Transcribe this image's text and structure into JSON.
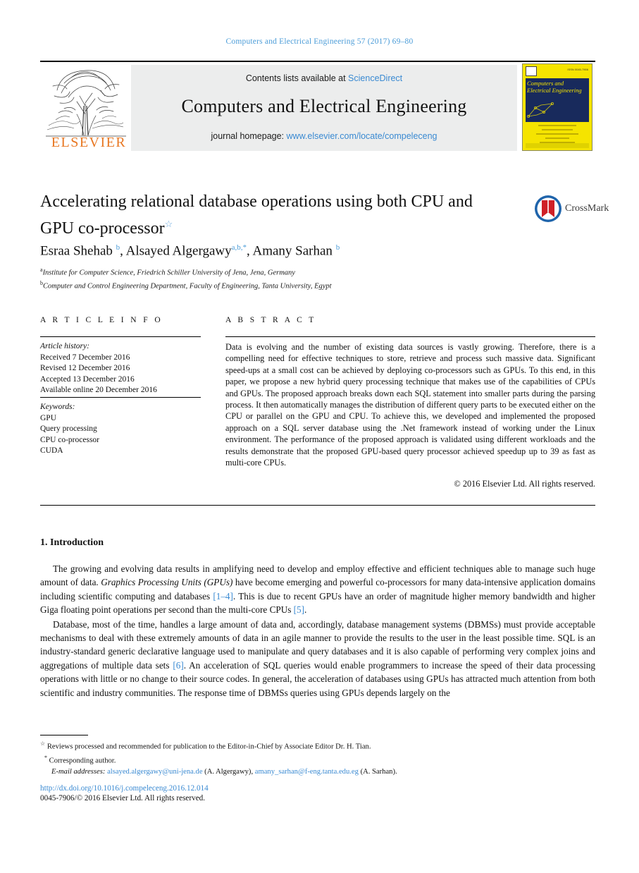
{
  "running_head": "Computers and Electrical Engineering 57 (2017) 69–80",
  "masthead": {
    "contents_prefix": "Contents lists available at ",
    "sciencedirect": "ScienceDirect",
    "journal_title": "Computers and Electrical Engineering",
    "homepage_prefix": "journal homepage: ",
    "homepage_url": "www.elsevier.com/locate/compeleceng",
    "publisher_wordmark": "ELSEVIER",
    "cover": {
      "title_line1": "Computers and",
      "title_line2": "Electrical Engineering",
      "issn_note": "ISSN 0045-7906"
    }
  },
  "article": {
    "title": "Accelerating relational database operations using both CPU and GPU co-processor",
    "title_footnote_marker": "☆",
    "crossmark_label": "CrossMark",
    "authors_html": "Esraa Shehab <sup>b</sup>, Alsayed Algergawy<sup>a,b,</sup><sup>*</sup>, Amany Sarhan <sup>b</sup>",
    "affiliations": [
      {
        "marker": "a",
        "text": "Institute for Computer Science, Friedrich Schiller University of Jena, Jena, Germany"
      },
      {
        "marker": "b",
        "text": "Computer and Control Engineering Department, Faculty of Engineering, Tanta University, Egypt"
      }
    ]
  },
  "info": {
    "heading": "A R T I C L E    I N F O",
    "history_label": "Article history:",
    "history": [
      "Received 7 December 2016",
      "Revised 12 December 2016",
      "Accepted 13 December 2016",
      "Available online 20 December 2016"
    ],
    "keywords_label": "Keywords:",
    "keywords": [
      "GPU",
      "Query processing",
      "CPU co-processor",
      "CUDA"
    ]
  },
  "abstract": {
    "heading": "A B S T R A C T",
    "text": "Data is evolving and the number of existing data sources is vastly growing. Therefore, there is a compelling need for effective techniques to store, retrieve and process such massive data. Significant speed-ups at a small cost can be achieved by deploying co-processors such as GPUs. To this end, in this paper, we propose a new hybrid query processing technique that makes use of the capabilities of CPUs and GPUs. The proposed approach breaks down each SQL statement into smaller parts during the parsing process. It then automatically manages the distribution of different query parts to be executed either on the CPU or parallel on the GPU and CPU. To achieve this, we developed and implemented the proposed approach on a SQL server database using the .Net framework instead of working under the Linux environment. The performance of the proposed approach is validated using different workloads and the results demonstrate that the proposed GPU-based query processor achieved speedup up to 39 as fast as multi-core CPUs.",
    "copyright": "© 2016 Elsevier Ltd. All rights reserved."
  },
  "section": {
    "number_title": "1. Introduction",
    "paragraph1_parts": {
      "p1a": "The growing and evolving data results in amplifying need to develop and employ effective and efficient techniques able to manage such huge amount of data. ",
      "p1_italic": "Graphics Processing Units (GPUs)",
      "p1b": " have become emerging and powerful co-processors for many data-intensive application domains including scientific computing and databases ",
      "ref1": "[1–4]",
      "p1c": ". This is due to recent GPUs have an order of magnitude higher memory bandwidth and higher Giga floating point operations per second than the multi-core CPUs ",
      "ref2": "[5]",
      "p1d": "."
    },
    "paragraph2_parts": {
      "p2a": "Database, most of the time, handles a large amount of data and, accordingly, database management systems (DBMSs) must provide acceptable mechanisms to deal with these extremely amounts of data in an agile manner to provide the results to the user in the least possible time. SQL is an industry-standard generic declarative language used to manipulate and query databases and it is also capable of performing very complex joins and aggregations of multiple data sets ",
      "ref3": "[6]",
      "p2b": ". An acceleration of SQL queries would enable programmers to increase the speed of their data processing operations with little or no change to their source codes. In general, the acceleration of databases using GPUs has attracted much attention from both scientific and industry communities. The response time of DBMSs queries using GPUs depends largely on the"
    }
  },
  "footnotes": {
    "star_marker": "☆",
    "star_note": "Reviews processed and recommended for publication to the Editor-in-Chief by Associate Editor Dr. H. Tian.",
    "asterisk_marker": "*",
    "corresponding": "Corresponding author.",
    "email_label": "E-mail addresses:",
    "email1": "alsayed.algergawy@uni-jena.de",
    "email1_name": "(A. Algergawy),",
    "email2": "amany_sarhan@f-eng.tanta.edu.eg",
    "email2_name": "(A. Sarhan).",
    "doi": "http://dx.doi.org/10.1016/j.compeleceng.2016.12.014",
    "issn_line": "0045-7906/© 2016 Elsevier Ltd. All rights reserved."
  },
  "colors": {
    "link_blue": "#3a8ad2",
    "elsevier_orange": "#e87722",
    "cover_yellow": "#f5e400",
    "cover_navy": "#182a5c"
  }
}
